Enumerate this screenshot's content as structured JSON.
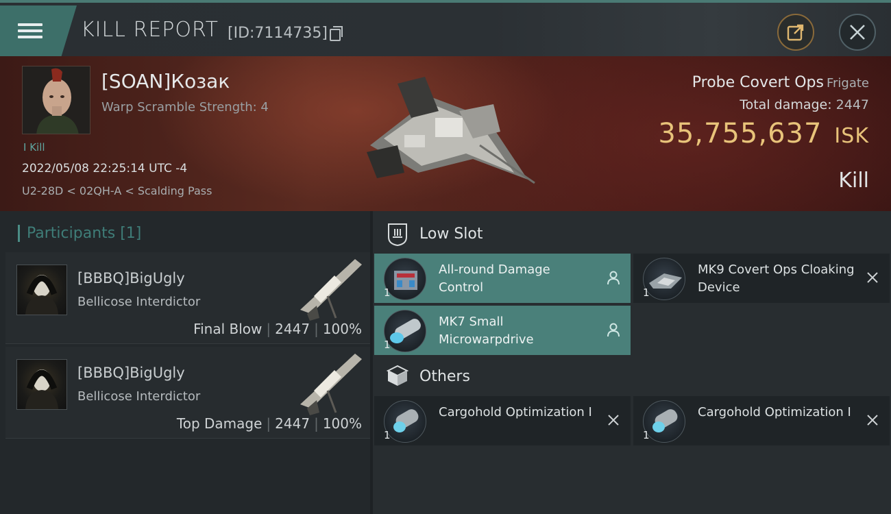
{
  "header": {
    "title": "KILL REPORT",
    "report_id": "[ID:7114735]"
  },
  "victim": {
    "name": "[SOAN]Козак",
    "warp_scramble": "Warp Scramble Strength: 4",
    "tag": "I Kill",
    "time": "2022/05/08 22:25:14 UTC -4",
    "location": "U2-28D < 02QH-A < Scalding Pass",
    "ship_name": "Probe Covert Ops",
    "ship_class": "Frigate",
    "total_damage_label": "Total damage:",
    "total_damage": "2447",
    "isk_value": "35,755,637",
    "isk_unit": "ISK",
    "outcome": "Kill"
  },
  "participants": {
    "header": "Participants [1]",
    "rows": [
      {
        "name": "[BBBQ]BigUgly",
        "ship": "Bellicose Interdictor",
        "role": "Final Blow",
        "damage": "2447",
        "percent": "100%"
      },
      {
        "name": "[BBBQ]BigUgly",
        "ship": "Bellicose Interdictor",
        "role": "Top Damage",
        "damage": "2447",
        "percent": "100%"
      }
    ]
  },
  "sections": {
    "low_slot": "Low Slot",
    "others": "Others"
  },
  "items": [
    {
      "name": "All-round Damage Control",
      "qty": "1",
      "status": "fitted"
    },
    {
      "name": "MK9 Covert Ops Cloaking Device",
      "qty": "1",
      "status": "destroyed"
    },
    {
      "name": "MK7 Small Microwarpdrive",
      "qty": "1",
      "status": "fitted"
    },
    {
      "name": "Cargohold Optimization I",
      "qty": "1",
      "status": "destroyed"
    },
    {
      "name": "Cargohold Optimization I",
      "qty": "1",
      "status": "destroyed"
    }
  ],
  "colors": {
    "accent": "#4a807a",
    "isk": "#e8c37a",
    "banner": "#5a2a20"
  },
  "icons": {
    "menu": "hamburger-menu-icon",
    "copy": "copy-icon",
    "share": "share-icon",
    "close": "close-icon",
    "low_slot": "low-slot-icon",
    "others": "cube-icon",
    "fitted": "person-icon",
    "destroyed": "x-icon"
  }
}
